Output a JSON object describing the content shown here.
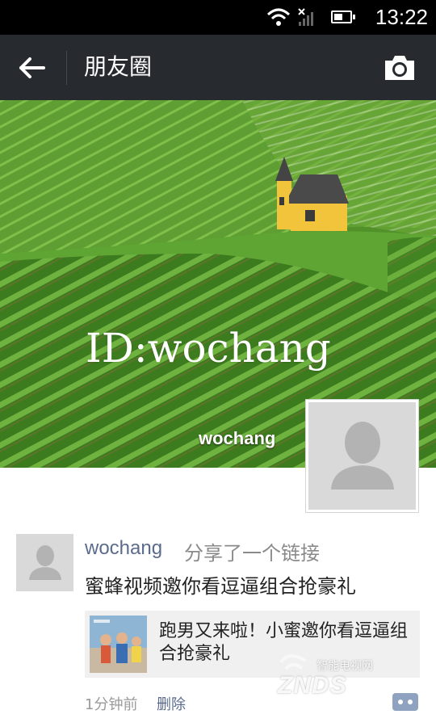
{
  "status_bar": {
    "time": "13:22",
    "icons": [
      "wifi-icon",
      "signal-icon",
      "battery-icon"
    ]
  },
  "header": {
    "title": "朋友圈",
    "back_icon": "arrow-left-icon",
    "camera_icon": "camera-icon"
  },
  "cover": {
    "overlay_text": "ID:wochang",
    "username": "wochang"
  },
  "post": {
    "username": "wochang",
    "action": "分享了一个链接",
    "text": "蜜蜂视频邀你看逗逼组合抢豪礼",
    "link_title": "跑男又来啦！小蜜邀你看逗逼组合抢豪礼",
    "time": "1分钟前",
    "delete_label": "删除"
  },
  "watermark": {
    "main": "ZNDS",
    "sub": "智能电视网"
  },
  "colors": {
    "titlebar_bg": "#272a2f",
    "name_link": "#5b6b8e",
    "card_bg": "#f0f0f0"
  }
}
